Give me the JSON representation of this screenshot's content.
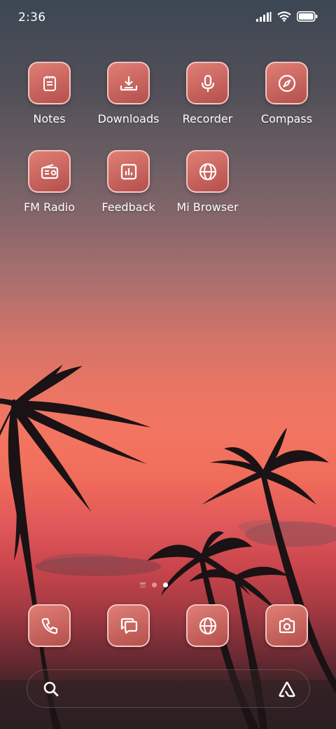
{
  "status_bar": {
    "time": "2:36",
    "icons": [
      "signal-icon",
      "wifi-icon",
      "battery-icon"
    ]
  },
  "home_apps": [
    {
      "label": "Notes",
      "icon": "notes-icon"
    },
    {
      "label": "Downloads",
      "icon": "download-icon"
    },
    {
      "label": "Recorder",
      "icon": "microphone-icon"
    },
    {
      "label": "Compass",
      "icon": "compass-icon"
    },
    {
      "label": "FM Radio",
      "icon": "radio-icon"
    },
    {
      "label": "Feedback",
      "icon": "bar-chart-icon"
    },
    {
      "label": "Mi Browser",
      "icon": "globe-icon"
    }
  ],
  "page_indicator": {
    "pages": 2,
    "active": 2
  },
  "dock": [
    {
      "icon": "phone-icon"
    },
    {
      "icon": "messages-icon"
    },
    {
      "icon": "globe-icon"
    },
    {
      "icon": "camera-icon"
    }
  ],
  "search_bar": {
    "icons": [
      "search-icon",
      "assistant-icon"
    ]
  },
  "colors": {
    "tile_top": "#e07e75",
    "tile_bottom": "#b5504d",
    "tile_border": "#ffe6e1"
  }
}
